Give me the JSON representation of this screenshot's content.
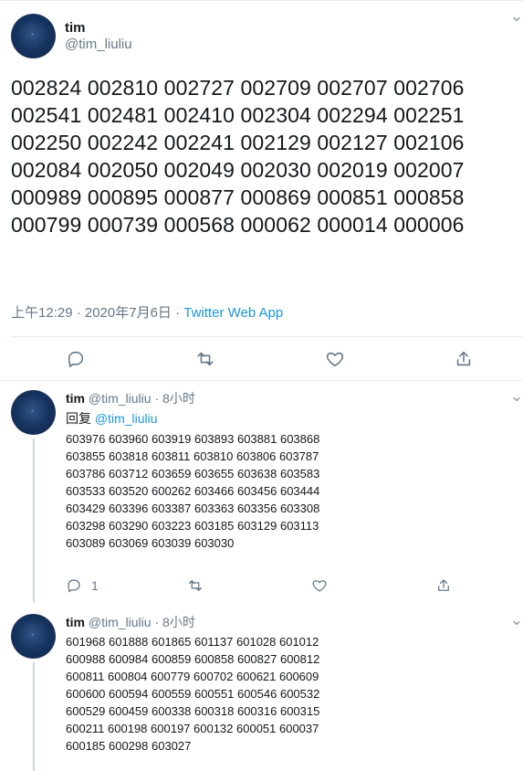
{
  "main_tweet": {
    "author": {
      "name": "tim",
      "handle": "@tim_liuliu"
    },
    "text": "002824 002810 002727 002709 002707 002706 002541 002481 002410 002304 002294 002251 002250 002242 002241 002129 002127 002106 002084 002050 002049 002030 002019 002007 000989 000895 000877 000869 000851 000858 000799 000739 000568 000062 000014 000006",
    "timestamp": "上午12:29 · 2020年7月6日 · ",
    "source": "Twitter Web App"
  },
  "replies": [
    {
      "name": "tim",
      "handle": "@tim_liuliu",
      "time": "8小时",
      "reply_to_prefix": "回复 ",
      "reply_to_user": "@tim_liuliu",
      "text": "603976 603960 603919 603893 603881 603868 603855 603818 603811 603810 603806 603787 603786 603712 603659 603655 603638 603583 603533 603520 600262 603466 603456 603444 603429 603396 603387 603363 603356 603308 603298 603290 603223 603185 603129 603113 603089 603069 603039 603030",
      "reply_count": "1"
    },
    {
      "name": "tim",
      "handle": "@tim_liuliu",
      "time": "8小时",
      "text": "601968 601888 601865 601137 601028 601012 600988 600984 600859 600858 600827 600812 600811 600804 600779 600702 600621 600609 600600 600594 600559 600551 600546 600532 600529 600459 600338 600318 600316 600315 600211 600198 600197 600132 600051 600037 600185 600298 603027"
    }
  ],
  "ui": {
    "separator_dot": "·",
    "colors": {
      "text": "#14171a",
      "secondary": "#657786",
      "accent": "#1b95e0",
      "divider": "#e6ecf0",
      "thread_line": "#ccd6dd"
    },
    "icons": [
      "chevron-down-icon",
      "reply-icon",
      "retweet-icon",
      "like-icon",
      "share-icon"
    ]
  }
}
